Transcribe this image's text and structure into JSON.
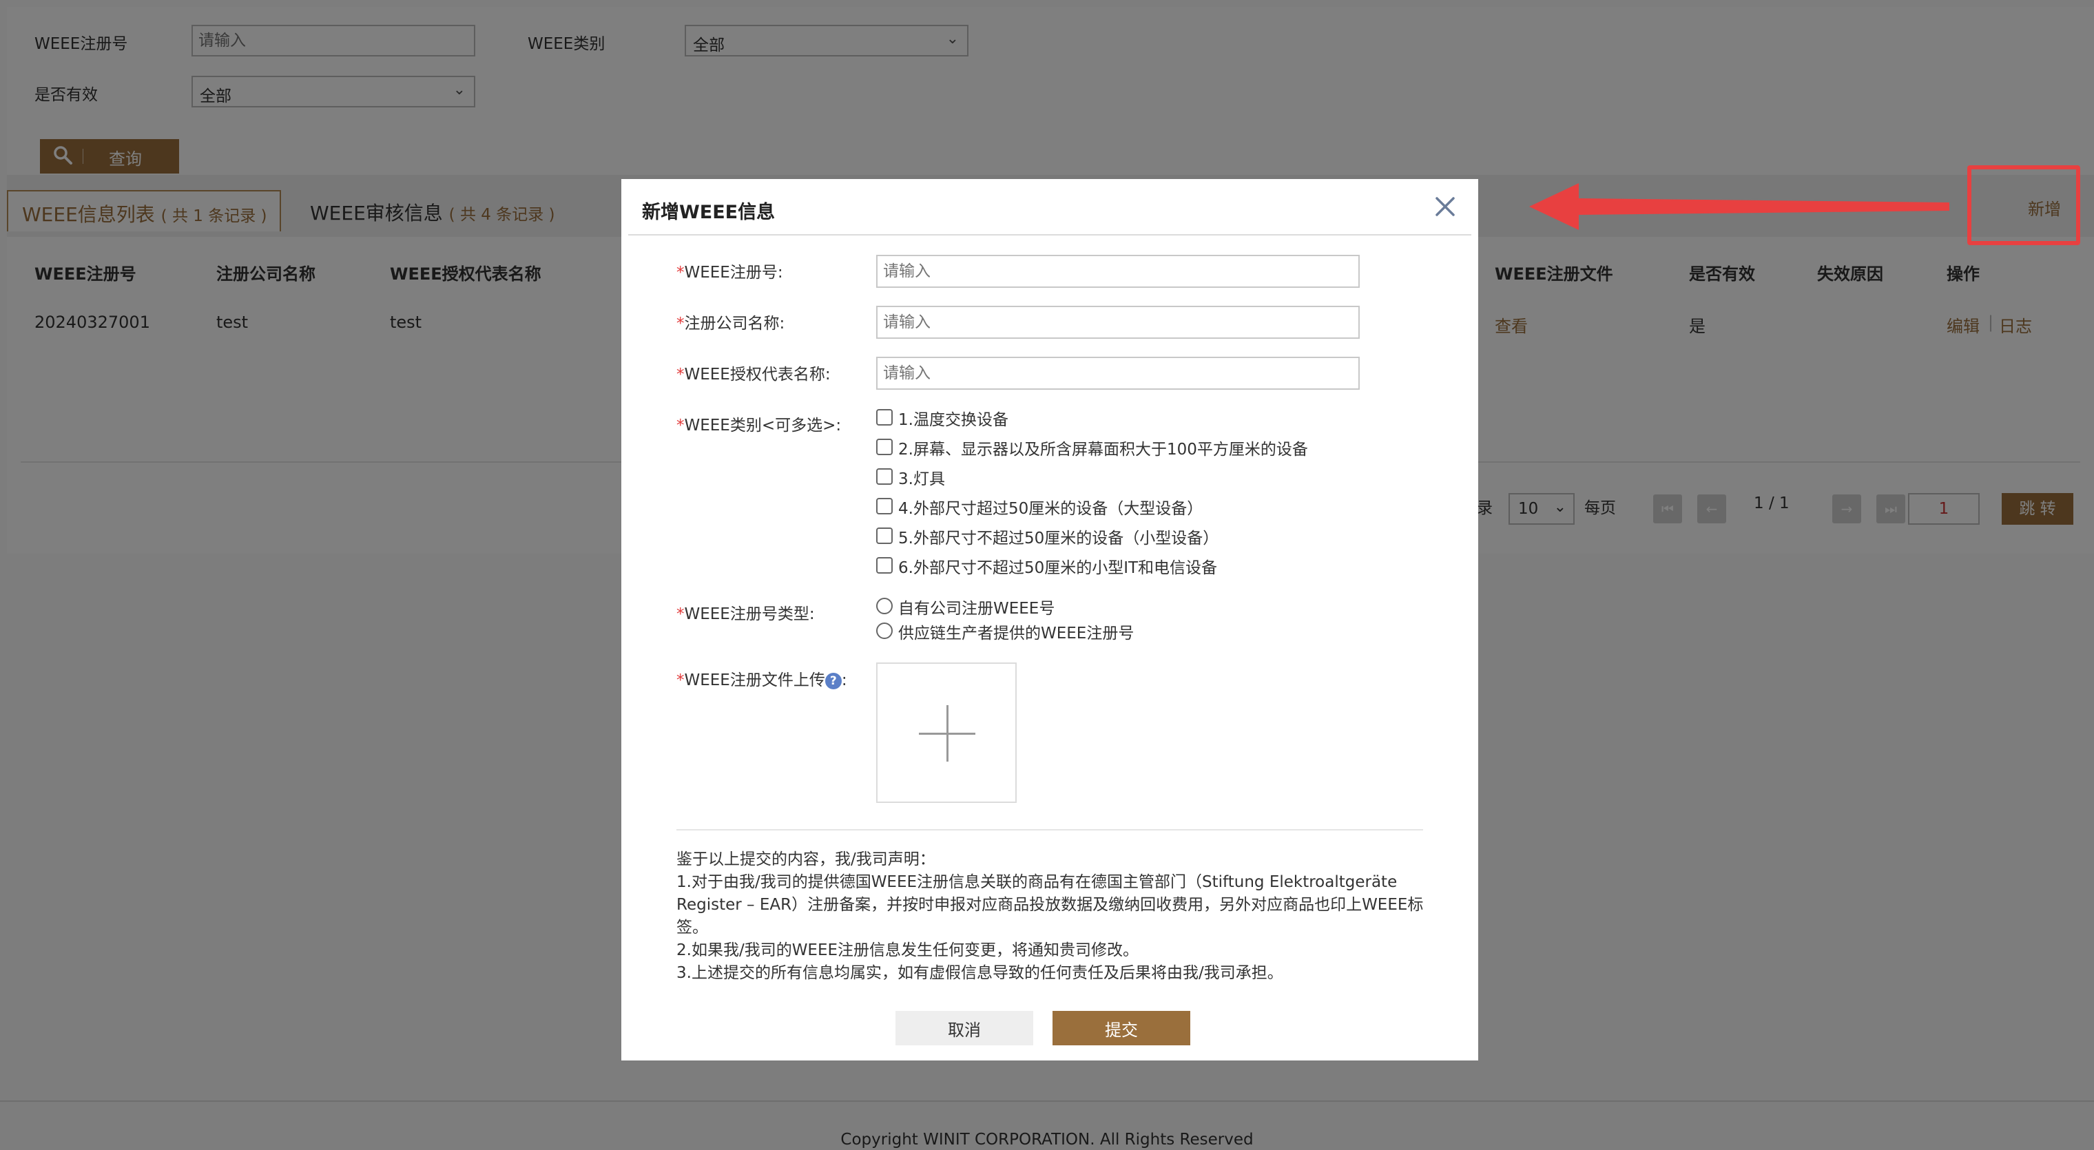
{
  "search": {
    "reg_no_label": "WEEE注册号",
    "reg_no_placeholder": "请输入",
    "category_label": "WEEE类别",
    "category_value": "全部",
    "valid_label": "是否有效",
    "valid_value": "全部",
    "query_label": "查询"
  },
  "tabs": [
    {
      "label": "WEEE信息列表",
      "count": "( 共 1 条记录 )"
    },
    {
      "label": "WEEE审核信息",
      "count": "( 共 4 条记录 )"
    }
  ],
  "add_label": "新增",
  "table": {
    "headers_left": [
      "WEEE注册号",
      "注册公司名称",
      "WEEE授权代表名称"
    ],
    "headers_right": [
      "WEEE注册文件",
      "是否有效",
      "失效原因",
      "操作"
    ],
    "row": {
      "reg_no": "20240327001",
      "company": "test",
      "rep": "test",
      "file": "查看",
      "valid": "是",
      "op_edit": "编辑",
      "op_sep": "|",
      "op_log": "日志"
    }
  },
  "pager": {
    "record_suffix": "录",
    "page_size": "10",
    "per_page": "每页",
    "page_info": "1 / 1",
    "jump_value": "1",
    "jump_label": "跳 转"
  },
  "footer": "Copyright WINIT CORPORATION. All Rights Reserved",
  "modal": {
    "title": "新增WEEE信息",
    "req_mark": "*",
    "fields": {
      "reg_no": "WEEE注册号:",
      "company": "注册公司名称:",
      "rep": "WEEE授权代表名称:",
      "placeholder": "请输入",
      "category": "WEEE类别<可多选>:",
      "reg_type": "WEEE注册号类型:",
      "upload": "WEEE注册文件上传"
    },
    "categories": [
      "1.温度交换设备",
      "2.屏幕、显示器以及所含屏幕面积大于100平方厘米的设备",
      "3.灯具",
      "4.外部尺寸超过50厘米的设备（大型设备）",
      "5.外部尺寸不超过50厘米的设备（小型设备）",
      "6.外部尺寸不超过50厘米的小型IT和电信设备"
    ],
    "reg_types": [
      "自有公司注册WEEE号",
      "供应链生产者提供的WEEE注册号"
    ],
    "help_glyph": "?",
    "upload_colon": ":",
    "declaration": [
      "鉴于以上提交的内容，我/我司声明：",
      "1.对于由我/我司的提供德国WEEE注册信息关联的商品有在德国主管部门（Stiftung Elektroaltgeräte Register – EAR）注册备案，并按时申报对应商品投放数据及缴纳回收费用，另外对应商品也印上WEEE标签。",
      "2.如果我/我司的WEEE注册信息发生任何变更，将通知贵司修改。",
      "3.上述提交的所有信息均属实，如有虚假信息导致的任何责任及后果将由我/我司承担。"
    ],
    "cancel_label": "取消",
    "submit_label": "提交"
  },
  "colors": {
    "accent": "#9a6f3c",
    "annotation": "#e84040",
    "required": "#e23b3b"
  }
}
